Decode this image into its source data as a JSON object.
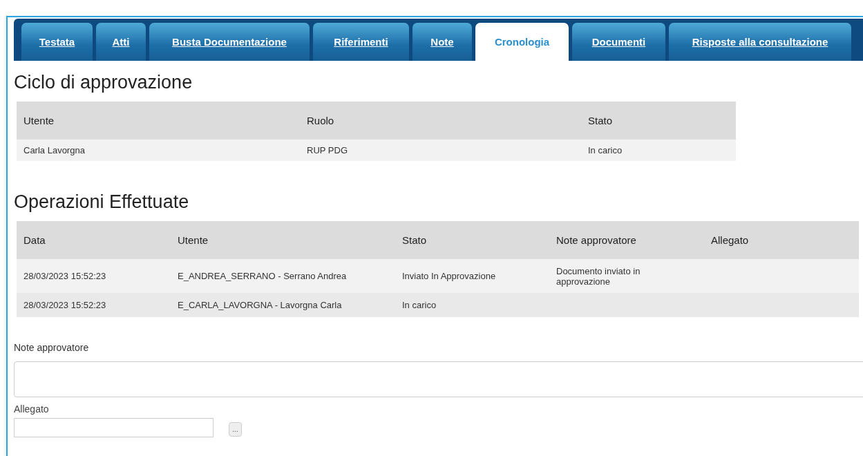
{
  "tabs": [
    {
      "label": "Testata",
      "selected": false
    },
    {
      "label": "Atti",
      "selected": false
    },
    {
      "label": "Busta Documentazione",
      "selected": false
    },
    {
      "label": "Riferimenti",
      "selected": false
    },
    {
      "label": "Note",
      "selected": false
    },
    {
      "label": "Cronologia",
      "selected": true
    },
    {
      "label": "Documenti",
      "selected": false
    },
    {
      "label": "Risposte alla consultazione",
      "selected": false
    }
  ],
  "approval_cycle": {
    "title": "Ciclo di approvazione",
    "columns": [
      "Utente",
      "Ruolo",
      "Stato"
    ],
    "rows": [
      [
        "Carla Lavorgna",
        "RUP PDG",
        "In carico"
      ]
    ]
  },
  "operations": {
    "title": "Operazioni Effettuate",
    "columns": [
      "Data",
      "Utente",
      "Stato",
      "Note approvatore",
      "Allegato"
    ],
    "rows": [
      [
        "28/03/2023 15:52:23",
        "E_ANDREA_SERRANO - Serrano Andrea",
        "Inviato In Approvazione",
        "Documento inviato in approvazione",
        ""
      ],
      [
        "28/03/2023 15:52:23",
        "E_CARLA_LAVORGNA - Lavorgna Carla",
        "In carico",
        "",
        ""
      ]
    ]
  },
  "form": {
    "notes_label": "Note approvatore",
    "attachment_label": "Allegato",
    "browse_button": "..."
  }
}
